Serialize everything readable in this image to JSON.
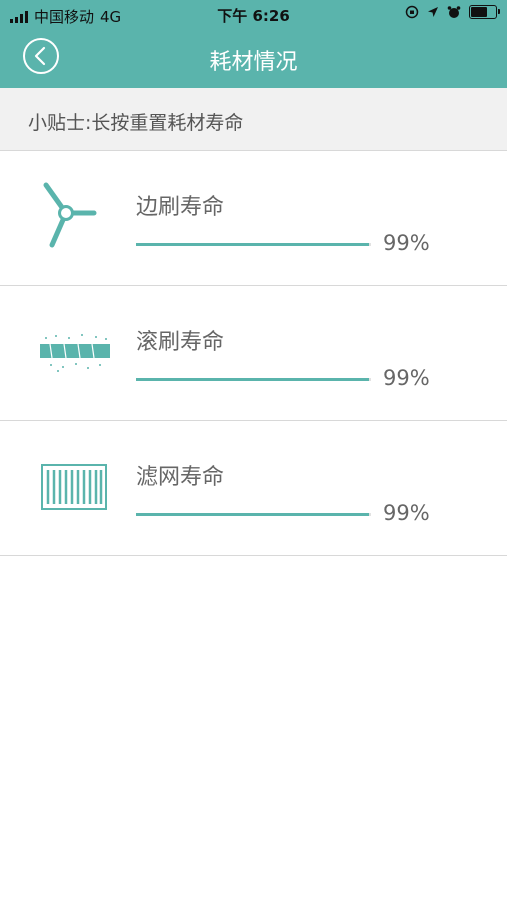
{
  "status_bar": {
    "carrier": "中国移动",
    "network": "4G",
    "time": "下午 6:26",
    "battery_level": 0.75
  },
  "header": {
    "title": "耗材情况",
    "back_icon": "chevron-left-icon",
    "color": "#5ab4ac"
  },
  "tip": {
    "text": "小贴士:长按重置耗材寿命"
  },
  "items": [
    {
      "label": "边刷寿命",
      "percent_text": "99%",
      "percent": 99,
      "icon": "side-brush-icon"
    },
    {
      "label": "滚刷寿命",
      "percent_text": "99%",
      "percent": 99,
      "icon": "roller-brush-icon"
    },
    {
      "label": "滤网寿命",
      "percent_text": "99%",
      "percent": 99,
      "icon": "filter-icon"
    }
  ]
}
